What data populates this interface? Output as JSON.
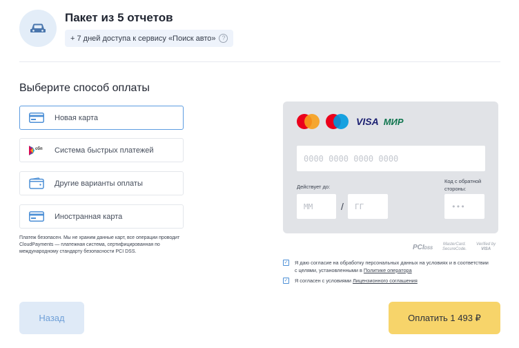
{
  "header": {
    "title": "Пакет из 5 отчетов",
    "badge_text": "+ 7 дней доступа к сервису «Поиск авто»",
    "help_glyph": "?"
  },
  "payment": {
    "section_title": "Выберите способ оплаты",
    "methods": [
      {
        "label": "Новая карта",
        "icon": "card-icon"
      },
      {
        "label": "Система быстрых платежей",
        "icon": "sbp-icon"
      },
      {
        "label": "Другие варианты оплаты",
        "icon": "wallet-icon"
      },
      {
        "label": "Иностранная карта",
        "icon": "card-icon"
      }
    ],
    "safety_note": "Платеж безопасен. Мы не храним данные карт, все операции проводит CloudPayments — платежная система, сертифицированная по международному стандарту безопасности PCI DSS."
  },
  "card_form": {
    "brands": [
      "VISA",
      "МИР"
    ],
    "card_number_placeholder": "0000 0000 0000 0000",
    "valid_label": "Действует до:",
    "month_placeholder": "ММ",
    "slash": "/",
    "year_placeholder": "ГГ",
    "cvc_label": "Код с обратной стороны:",
    "cvc_placeholder": "•••"
  },
  "security_logos": {
    "pci": "PCI",
    "pci_small": "DSS",
    "mastercard_line1": "MasterCard.",
    "mastercard_line2": "SecureCode.",
    "visa_line1": "Verified by",
    "visa_line2": "VISA"
  },
  "consents": [
    {
      "text": "Я даю согласие на обработку персональных данных на условиях и в соответствии с целями, установленными в ",
      "link": "Политике оператора"
    },
    {
      "text": "Я согласен с условиями ",
      "link": "Лицензионного соглашения"
    }
  ],
  "footer": {
    "back_label": "Назад",
    "pay_label": "Оплатить 1 493 ₽"
  },
  "colors": {
    "accent_blue": "#5b9be0",
    "pay_yellow": "#f7d46a",
    "back_bg": "#dfeaf7",
    "card_panel": "#e1e3e7",
    "mastercard_red": "#eb001b",
    "mastercard_orange": "#f79e1b",
    "maestro_blue": "#0099df"
  }
}
